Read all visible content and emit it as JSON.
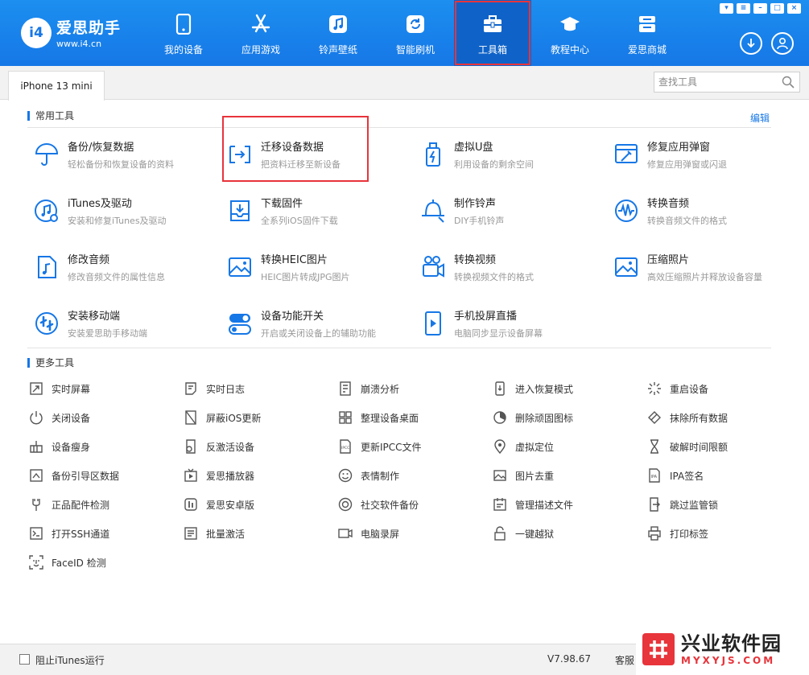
{
  "app": {
    "name": "爱思助手",
    "url": "www.i4.cn",
    "logo_mark": "i4"
  },
  "nav": [
    {
      "label": "我的设备",
      "icon": "phone-icon"
    },
    {
      "label": "应用游戏",
      "icon": "appstore-icon"
    },
    {
      "label": "铃声壁纸",
      "icon": "music-note-icon"
    },
    {
      "label": "智能刷机",
      "icon": "refresh-icon"
    },
    {
      "label": "工具箱",
      "icon": "toolbox-icon"
    },
    {
      "label": "教程中心",
      "icon": "graduation-cap-icon"
    },
    {
      "label": "爱思商城",
      "icon": "shop-icon"
    }
  ],
  "active_nav": "工具箱",
  "device_tab": "iPhone 13 mini",
  "search": {
    "placeholder": "查找工具"
  },
  "common": {
    "title": "常用工具",
    "edit": "编辑",
    "tools": [
      {
        "title": "备份/恢复数据",
        "desc": "轻松备份和恢复设备的资料",
        "icon": "umbrella-icon"
      },
      {
        "title": "迁移设备数据",
        "desc": "把资料迁移至新设备",
        "icon": "migrate-icon"
      },
      {
        "title": "虚拟U盘",
        "desc": "利用设备的剩余空间",
        "icon": "usb-drive-icon"
      },
      {
        "title": "修复应用弹窗",
        "desc": "修复应用弹窗或闪退",
        "icon": "repair-window-icon"
      },
      {
        "title": "iTunes及驱动",
        "desc": "安装和修复iTunes及驱动",
        "icon": "itunes-icon"
      },
      {
        "title": "下载固件",
        "desc": "全系列iOS固件下载",
        "icon": "firmware-download-icon"
      },
      {
        "title": "制作铃声",
        "desc": "DIY手机铃声",
        "icon": "bell-icon"
      },
      {
        "title": "转换音频",
        "desc": "转换音频文件的格式",
        "icon": "audio-wave-icon"
      },
      {
        "title": "修改音频",
        "desc": "修改音频文件的属性信息",
        "icon": "audio-file-icon"
      },
      {
        "title": "转换HEIC图片",
        "desc": "HEIC图片转成JPG图片",
        "icon": "heic-image-icon"
      },
      {
        "title": "转换视频",
        "desc": "转换视频文件的格式",
        "icon": "video-convert-icon"
      },
      {
        "title": "压缩照片",
        "desc": "高效压缩照片并释放设备容量",
        "icon": "compress-photo-icon"
      },
      {
        "title": "安装移动端",
        "desc": "安装爱思助手移动端",
        "icon": "install-mobile-icon"
      },
      {
        "title": "设备功能开关",
        "desc": "开启或关闭设备上的辅助功能",
        "icon": "toggle-switch-icon"
      },
      {
        "title": "手机投屏直播",
        "desc": "电脑同步显示设备屏幕",
        "icon": "screen-mirror-icon"
      }
    ]
  },
  "more": {
    "title": "更多工具",
    "tools": [
      {
        "label": "实时屏幕",
        "icon": "realtime-screen-icon"
      },
      {
        "label": "实时日志",
        "icon": "log-icon"
      },
      {
        "label": "崩溃分析",
        "icon": "crash-report-icon"
      },
      {
        "label": "进入恢复模式",
        "icon": "recovery-mode-icon"
      },
      {
        "label": "重启设备",
        "icon": "restart-icon"
      },
      {
        "label": "关闭设备",
        "icon": "power-icon"
      },
      {
        "label": "屏蔽iOS更新",
        "icon": "block-update-icon"
      },
      {
        "label": "整理设备桌面",
        "icon": "grid-icon"
      },
      {
        "label": "删除顽固图标",
        "icon": "delete-icon-icon"
      },
      {
        "label": "抹除所有数据",
        "icon": "eraser-icon"
      },
      {
        "label": "设备瘦身",
        "icon": "clean-icon"
      },
      {
        "label": "反激活设备",
        "icon": "deactivate-icon"
      },
      {
        "label": "更新IPCC文件",
        "icon": "ipcc-file-icon"
      },
      {
        "label": "虚拟定位",
        "icon": "location-pin-icon"
      },
      {
        "label": "破解时间限额",
        "icon": "hourglass-icon"
      },
      {
        "label": "备份引导区数据",
        "icon": "backup-boot-icon"
      },
      {
        "label": "爱思播放器",
        "icon": "tv-player-icon"
      },
      {
        "label": "表情制作",
        "icon": "emoji-icon"
      },
      {
        "label": "图片去重",
        "icon": "image-dedupe-icon"
      },
      {
        "label": "IPA签名",
        "icon": "ipa-sign-icon"
      },
      {
        "label": "正品配件检测",
        "icon": "accessory-check-icon"
      },
      {
        "label": "爱思安卓版",
        "icon": "i4-android-icon"
      },
      {
        "label": "社交软件备份",
        "icon": "social-backup-icon"
      },
      {
        "label": "管理描述文件",
        "icon": "profile-manage-icon"
      },
      {
        "label": "跳过监管锁",
        "icon": "supervision-lock-icon"
      },
      {
        "label": "打开SSH通道",
        "icon": "ssh-terminal-icon"
      },
      {
        "label": "批量激活",
        "icon": "batch-activate-icon"
      },
      {
        "label": "电脑录屏",
        "icon": "screen-record-icon"
      },
      {
        "label": "一键越狱",
        "icon": "jailbreak-lock-icon"
      },
      {
        "label": "打印标签",
        "icon": "printer-icon"
      },
      {
        "label": "FaceID 检测",
        "icon": "faceid-icon"
      }
    ]
  },
  "footer": {
    "block_itunes": "阻止iTunes运行",
    "version": "V7.98.67",
    "service": "客服"
  },
  "watermark": {
    "cn": "兴业软件园",
    "en": "MYXYJS.COM"
  },
  "colors": {
    "header_blue": "#1677e6",
    "accent_blue": "#1677e6",
    "highlight_red": "#e8343b"
  }
}
